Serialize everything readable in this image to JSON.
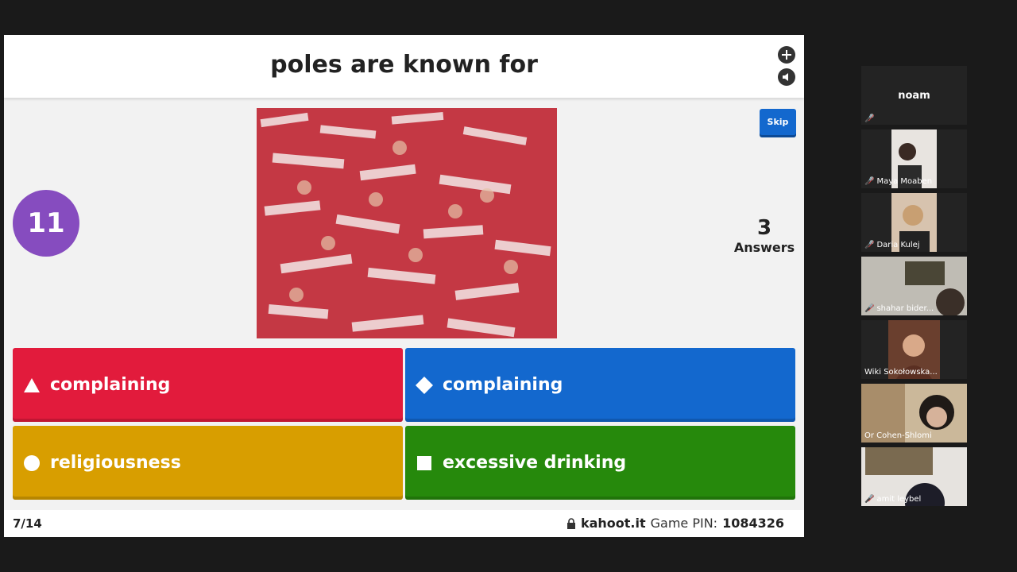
{
  "question": {
    "title": "poles are known for"
  },
  "timer": {
    "value": "11"
  },
  "skip": {
    "label": "Skip"
  },
  "answers_count": {
    "number": "3",
    "label": "Answers"
  },
  "answers": [
    {
      "label": "complaining",
      "shape": "triangle-icon",
      "color": "#e21b3c"
    },
    {
      "label": "complaining",
      "shape": "diamond-icon",
      "color": "#1368ce"
    },
    {
      "label": "religiousness",
      "shape": "circle-icon",
      "color": "#d89e00"
    },
    {
      "label": "excessive drinking",
      "shape": "square-icon",
      "color": "#26890c"
    }
  ],
  "footer": {
    "progress": "7/14",
    "site": "kahoot.it",
    "pin_label": "Game PIN:",
    "pin": "1084326"
  },
  "participants": [
    {
      "name": "noam",
      "muted": true,
      "video": false
    },
    {
      "name": "Maya Moaben",
      "muted": true,
      "video": true
    },
    {
      "name": "Daria Kulej",
      "muted": true,
      "video": true
    },
    {
      "name": "shahar bider...",
      "muted": true,
      "video": true
    },
    {
      "name": "Wiki Sokołowska...",
      "muted": false,
      "video": true
    },
    {
      "name": "Or Cohen-Shlomi",
      "muted": false,
      "video": true
    },
    {
      "name": "amit leybel",
      "muted": true,
      "video": true
    }
  ]
}
